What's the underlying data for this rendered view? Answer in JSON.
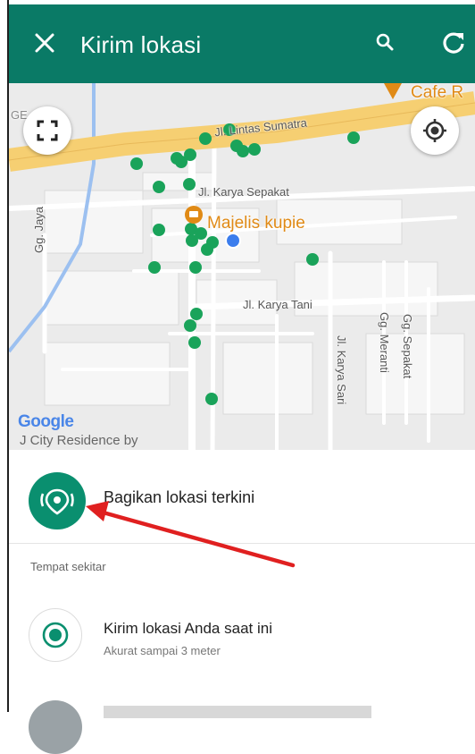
{
  "app_bar": {
    "title": "Kirim lokasi",
    "close_icon": "close-icon",
    "search_icon": "search-icon",
    "refresh_icon": "refresh-icon",
    "color": "#0a7a66"
  },
  "map": {
    "streets": {
      "lintas_sumatra": "Jl. Lintas Sumatra",
      "karya_sepakat": "Jl. Karya Sepakat",
      "gg_jaya": "Gg. Jaya",
      "karya_tani": "Jl. Karya Tani",
      "gg_meranti": "Gg. Meranti",
      "gg_sepakat": "Gg. Sepakat",
      "karya_sari": "Jl. Karya Sari"
    },
    "places": {
      "majelis": "Majelis kupie",
      "cafe": "Cafe R",
      "residence": "J City Residence by"
    },
    "google_logo": "Google",
    "corner_letters": "GE",
    "fullscreen_icon": "fullscreen-icon",
    "locate_icon": "my-location-icon"
  },
  "sheet": {
    "share_current_label": "Bagikan lokasi terkini",
    "nearby_title": "Tempat sekitar",
    "send_current_title": "Kirim lokasi Anda saat ini",
    "send_current_subtitle": "Akurat sampai 3 meter"
  },
  "colors": {
    "accent": "#0a8f6f",
    "pin_green": "#1aa35a",
    "my_location_blue": "#3b7ded",
    "arrow_red": "#e02020",
    "road_yellow": "#f6cf72"
  }
}
